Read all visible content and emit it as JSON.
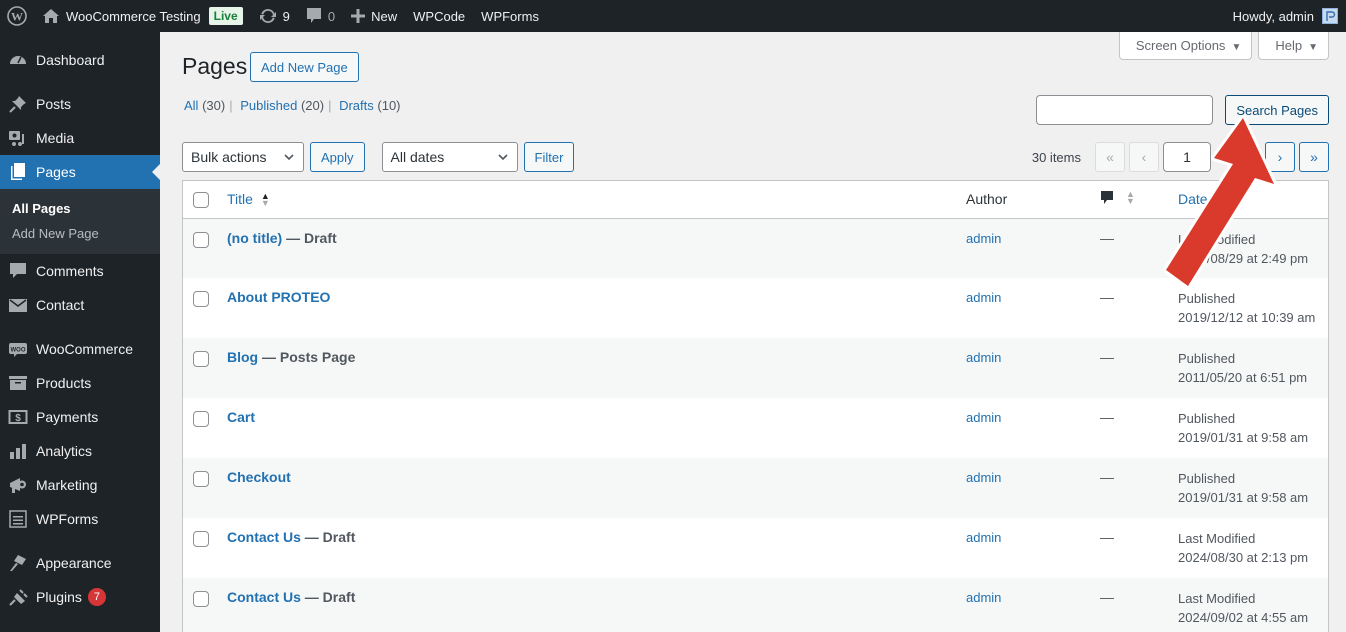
{
  "adminbar": {
    "site_name": "WooCommerce Testing",
    "live_badge": "Live",
    "updates_count": "9",
    "comments_count": "0",
    "new_label": "New",
    "wpcode_label": "WPCode",
    "wpforms_label": "WPForms",
    "greeting": "Howdy, admin"
  },
  "sidebar": {
    "items": [
      {
        "label": "Dashboard",
        "icon": "dashboard-icon"
      },
      {
        "label": "Posts",
        "icon": "pin-icon"
      },
      {
        "label": "Media",
        "icon": "media-icon"
      },
      {
        "label": "Pages",
        "icon": "pages-icon"
      },
      {
        "label": "Comments",
        "icon": "comment-icon"
      },
      {
        "label": "Contact",
        "icon": "mail-icon"
      },
      {
        "label": "WooCommerce",
        "icon": "woo-icon"
      },
      {
        "label": "Products",
        "icon": "archive-icon"
      },
      {
        "label": "Payments",
        "icon": "dollar-icon"
      },
      {
        "label": "Analytics",
        "icon": "bar-chart-icon"
      },
      {
        "label": "Marketing",
        "icon": "megaphone-icon"
      },
      {
        "label": "WPForms",
        "icon": "form-icon"
      },
      {
        "label": "Appearance",
        "icon": "brush-icon"
      },
      {
        "label": "Plugins",
        "icon": "plug-icon",
        "badge": "7"
      }
    ],
    "pages_submenu": [
      "All Pages",
      "Add New Page"
    ]
  },
  "screen_meta": {
    "screen_options": "Screen Options",
    "help": "Help"
  },
  "header": {
    "title": "Pages",
    "add_new": "Add New Page"
  },
  "views": [
    {
      "label": "All",
      "count": "(30)"
    },
    {
      "label": "Published",
      "count": "(20)"
    },
    {
      "label": "Drafts",
      "count": "(10)"
    }
  ],
  "search": {
    "value": "",
    "button": "Search Pages"
  },
  "tablenav": {
    "bulk_actions": "Bulk actions",
    "apply": "Apply",
    "dates": "All dates",
    "filter": "Filter",
    "items_count": "30 items",
    "first": "«",
    "prev": "‹",
    "current_page": "1",
    "next": "›",
    "last": "»"
  },
  "table": {
    "columns": {
      "title": "Title",
      "author": "Author",
      "comments_icon": "comment-bubble-icon",
      "date": "Date"
    },
    "rows": [
      {
        "title": "(no title)",
        "state": "— Draft",
        "author": "admin",
        "comments": "—",
        "status": "Last Modified",
        "date": "2024/08/29 at 2:49 pm"
      },
      {
        "title": "About PROTEO",
        "state": "",
        "author": "admin",
        "comments": "—",
        "status": "Published",
        "date": "2019/12/12 at 10:39 am"
      },
      {
        "title": "Blog",
        "state": "— Posts Page",
        "author": "admin",
        "comments": "—",
        "status": "Published",
        "date": "2011/05/20 at 6:51 pm"
      },
      {
        "title": "Cart",
        "state": "",
        "author": "admin",
        "comments": "—",
        "status": "Published",
        "date": "2019/01/31 at 9:58 am"
      },
      {
        "title": "Checkout",
        "state": "",
        "author": "admin",
        "comments": "—",
        "status": "Published",
        "date": "2019/01/31 at 9:58 am"
      },
      {
        "title": "Contact Us",
        "state": "— Draft",
        "author": "admin",
        "comments": "—",
        "status": "Last Modified",
        "date": "2024/08/30 at 2:13 pm"
      },
      {
        "title": "Contact Us",
        "state": "— Draft",
        "author": "admin",
        "comments": "—",
        "status": "Last Modified",
        "date": "2024/09/02 at 4:55 am"
      }
    ]
  },
  "colors": {
    "accent": "#2271b1",
    "adminbar_bg": "#1d2327",
    "annotation_arrow": "#d93a2b",
    "badge": "#d63638"
  }
}
